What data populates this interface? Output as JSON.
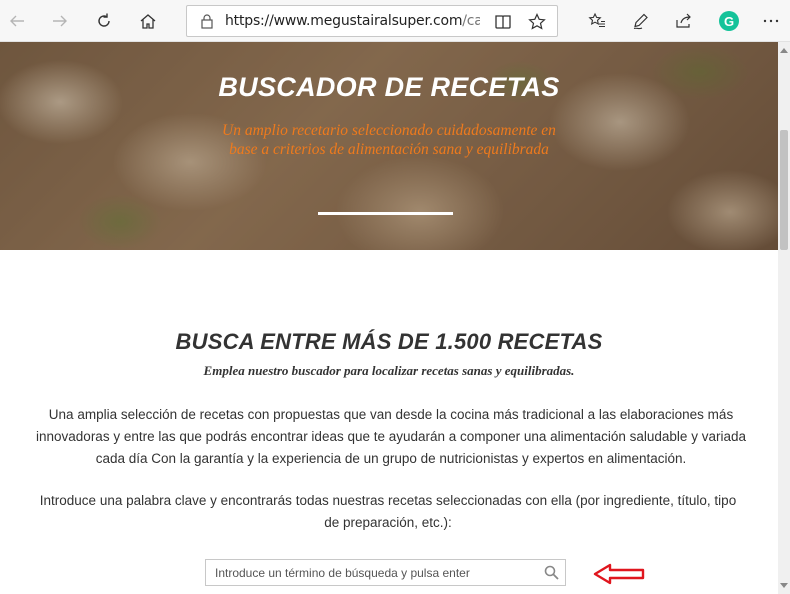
{
  "browser": {
    "url_host": "https://www.megustairalsuper.com",
    "url_path": "/canal-coc",
    "profile_initial": "G"
  },
  "hero": {
    "title": "BUSCADOR DE RECETAS",
    "subtitle": "Un amplio recetario seleccionado cuidadosamente en base a criterios de alimentación sana y equilibrada"
  },
  "main": {
    "heading": "BUSCA ENTRE MÁS DE 1.500 RECETAS",
    "subheading": "Emplea nuestro buscador para localizar recetas sanas y equilibradas.",
    "paragraph1": "Una amplia selección de recetas con propuestas que van desde la cocina más tradicional a las elaboraciones más innovadoras y entre las que podrás encontrar ideas que te ayudarán a componer una alimentación saludable y variada cada día Con la garantía y la experiencia de un grupo de nutricionistas y expertos en alimentación.",
    "paragraph2": "Introduce una palabra clave y encontrarás todas nuestras recetas seleccionadas con ella (por ingrediente, título, tipo de preparación, etc.):"
  },
  "search": {
    "placeholder": "Introduce un término de búsqueda y pulsa enter",
    "value": ""
  },
  "colors": {
    "accent_orange": "#ee7a1d",
    "arrow_red": "#e0161e",
    "grammarly_green": "#15c39a"
  }
}
